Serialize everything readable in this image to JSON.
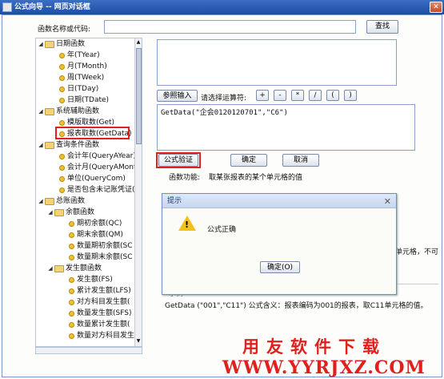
{
  "window": {
    "title": "公式向导 -- 网页对话框"
  },
  "search": {
    "label": "函数名称或代码:",
    "value": "",
    "button": "查找"
  },
  "tree": {
    "items": [
      {
        "label": "日期函数",
        "type": "folder"
      },
      {
        "label": "年(TYear)",
        "type": "leaf"
      },
      {
        "label": "月(TMonth)",
        "type": "leaf"
      },
      {
        "label": "周(TWeek)",
        "type": "leaf"
      },
      {
        "label": "日(TDay)",
        "type": "leaf"
      },
      {
        "label": "日期(TDate)",
        "type": "leaf"
      },
      {
        "label": "系统辅助函数",
        "type": "folder"
      },
      {
        "label": "模版取数(Get)",
        "type": "leaf"
      },
      {
        "label": "报表取数(GetData)",
        "type": "leaf"
      },
      {
        "label": "查询条件函数",
        "type": "folder"
      },
      {
        "label": "会计年(QueryAYear)",
        "type": "leaf"
      },
      {
        "label": "会计月(QueryAMonth",
        "type": "leaf"
      },
      {
        "label": "单位(QueryCom)",
        "type": "leaf"
      },
      {
        "label": "是否包含未记账凭证(",
        "type": "leaf"
      },
      {
        "label": "总账函数",
        "type": "folder"
      },
      {
        "label": "余额函数",
        "type": "folder"
      },
      {
        "label": "期初余额(QC)",
        "type": "leaf"
      },
      {
        "label": "期末余额(QM)",
        "type": "leaf"
      },
      {
        "label": "数量期初余额(SC",
        "type": "leaf"
      },
      {
        "label": "数量期末余额(SC",
        "type": "leaf"
      },
      {
        "label": "发生额函数",
        "type": "folder"
      },
      {
        "label": "发生额(FS)",
        "type": "leaf"
      },
      {
        "label": "累计发生额(LFS)",
        "type": "leaf"
      },
      {
        "label": "对方科目发生额(",
        "type": "leaf"
      },
      {
        "label": "数量发生额(SFS)",
        "type": "leaf"
      },
      {
        "label": "数量累计发生额(",
        "type": "leaf"
      },
      {
        "label": "数量对方科目发生",
        "type": "leaf"
      }
    ]
  },
  "toolbar": {
    "ref_input": "参照输入",
    "operator_label": "请选择运算符:",
    "operators": [
      "+",
      "-",
      "*",
      "/",
      "(",
      ")"
    ]
  },
  "formula": {
    "value": "GetData(\"企会0120120701\",\"C6\")"
  },
  "actions": {
    "verify": "公式验证",
    "ok": "确定",
    "cancel": "取消"
  },
  "description": {
    "label": "函数功能:",
    "text": "取某张报表的某个单元格的值",
    "partial_text": "单元格，不可"
  },
  "example": {
    "title": "示例",
    "text": "GetData (\"001\",\"C11\") 公式含义：报表编码为001的报表，取C11单元格的值。"
  },
  "dialog": {
    "title": "提示",
    "message": "公式正确",
    "ok": "确定(O)"
  },
  "watermark": {
    "logo": "用友软件下载",
    "url": "WWW.YYRJXZ.COM"
  }
}
